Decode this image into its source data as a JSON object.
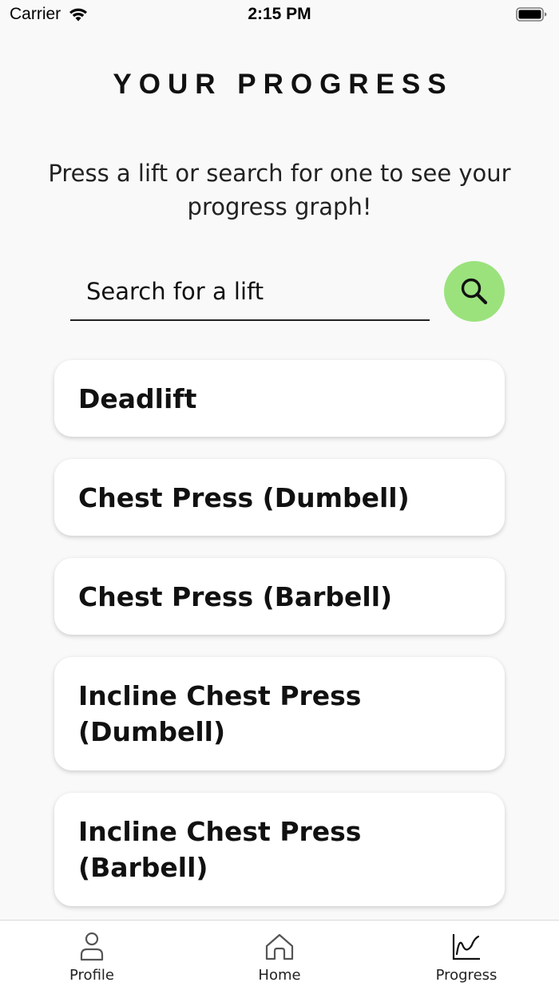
{
  "status_bar": {
    "carrier": "Carrier",
    "time": "2:15 PM"
  },
  "header": {
    "title": "YOUR PROGRESS",
    "instructions": "Press a lift or search for one to see your progress graph!"
  },
  "search": {
    "placeholder": "Search for a lift",
    "value": "",
    "button_color": "#9be27d",
    "button_icon": "search-icon"
  },
  "lifts": [
    {
      "label": "Deadlift"
    },
    {
      "label": "Chest Press (Dumbell)"
    },
    {
      "label": "Chest Press (Barbell)"
    },
    {
      "label": "Incline Chest Press (Dumbell)"
    },
    {
      "label": "Incline Chest Press (Barbell)"
    }
  ],
  "tab_bar": {
    "tabs": [
      {
        "label": "Profile",
        "icon": "person-icon"
      },
      {
        "label": "Home",
        "icon": "home-icon"
      },
      {
        "label": "Progress",
        "icon": "chart-icon"
      }
    ],
    "active": "Progress"
  }
}
